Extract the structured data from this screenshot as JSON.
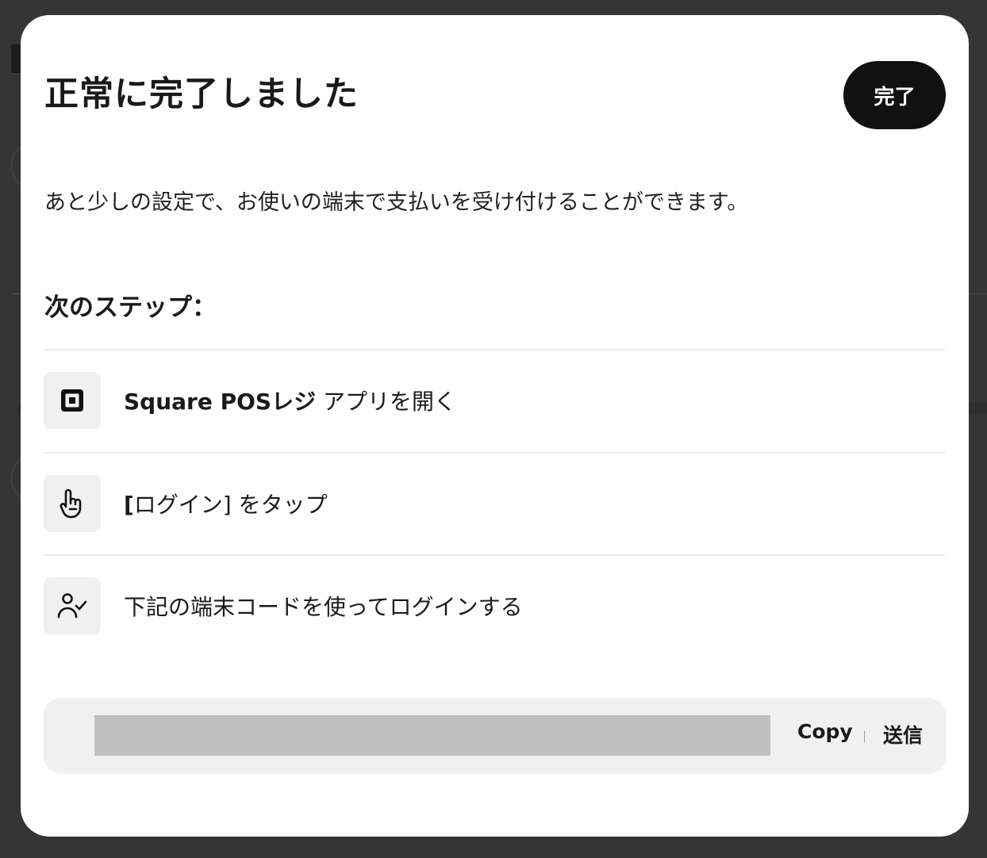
{
  "modal": {
    "title": "正常に完了しました",
    "done_label": "完了",
    "description": "あと少しの設定で、お使いの端末で支払いを受け付けることができます。",
    "next_steps_heading": "次のステップ："
  },
  "steps": [
    {
      "icon": "square-logo-icon",
      "bold": "Square POSレジ",
      "text": " アプリを開く"
    },
    {
      "icon": "tap-hand-icon",
      "bold": "[",
      "text": "ログイン] をタップ"
    },
    {
      "icon": "person-check-icon",
      "bold": "",
      "text": "下記の端末コードを使ってログインする"
    }
  ],
  "code_panel": {
    "copy_label": "Copy",
    "send_label": "送信"
  }
}
